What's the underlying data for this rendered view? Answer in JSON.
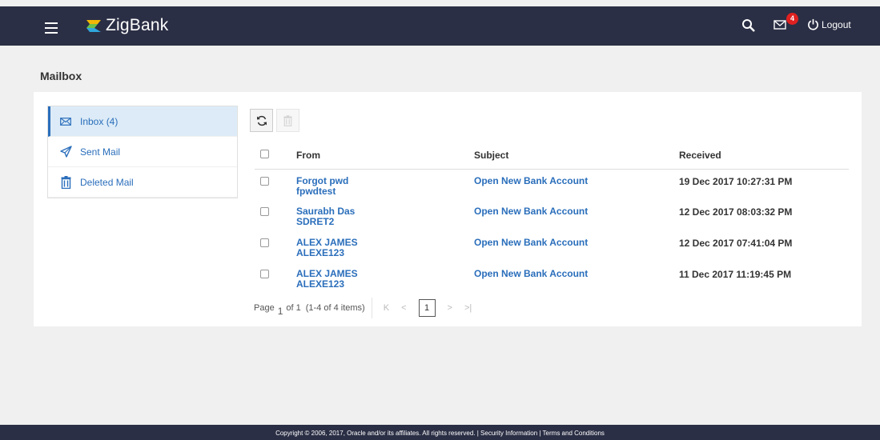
{
  "header": {
    "app_name": "ZigBank",
    "mail_badge": "4",
    "logout_label": "Logout"
  },
  "page": {
    "title": "Mailbox"
  },
  "sidebar": {
    "items": [
      {
        "label": "Inbox (4)",
        "icon": "envelope-icon",
        "active": true
      },
      {
        "label": "Sent Mail",
        "icon": "send-icon",
        "active": false
      },
      {
        "label": "Deleted Mail",
        "icon": "trash-icon",
        "active": false
      }
    ]
  },
  "table": {
    "columns": [
      "From",
      "Subject",
      "Received"
    ],
    "rows": [
      {
        "from_name": "Forgot pwd",
        "from_id": "fpwdtest",
        "subject": "Open New Bank Account",
        "received": "19 Dec 2017 10:27:31 PM"
      },
      {
        "from_name": "Saurabh Das",
        "from_id": "SDRET2",
        "subject": "Open New Bank Account",
        "received": "12 Dec 2017 08:03:32 PM"
      },
      {
        "from_name": "ALEX JAMES",
        "from_id": "ALEXE123",
        "subject": "Open New Bank Account",
        "received": "12 Dec 2017 07:41:04 PM"
      },
      {
        "from_name": "ALEX JAMES",
        "from_id": "ALEXE123",
        "subject": "Open New Bank Account",
        "received": "11 Dec 2017 11:19:45 PM"
      }
    ]
  },
  "pagination": {
    "page_label": "Page",
    "page_number": "1",
    "of_label": "of 1",
    "items_label": "(1-4 of 4 items)",
    "current_page": "1"
  },
  "footer": {
    "text": "Copyright © 2006, 2017, Oracle and/or its affiliates. All rights reserved. | Security Information | Terms and Conditions"
  },
  "colors": {
    "header_bg": "#2b2f45",
    "link": "#2a6ebb",
    "active_menu_bg": "#dcebf7",
    "badge": "#e02020"
  }
}
